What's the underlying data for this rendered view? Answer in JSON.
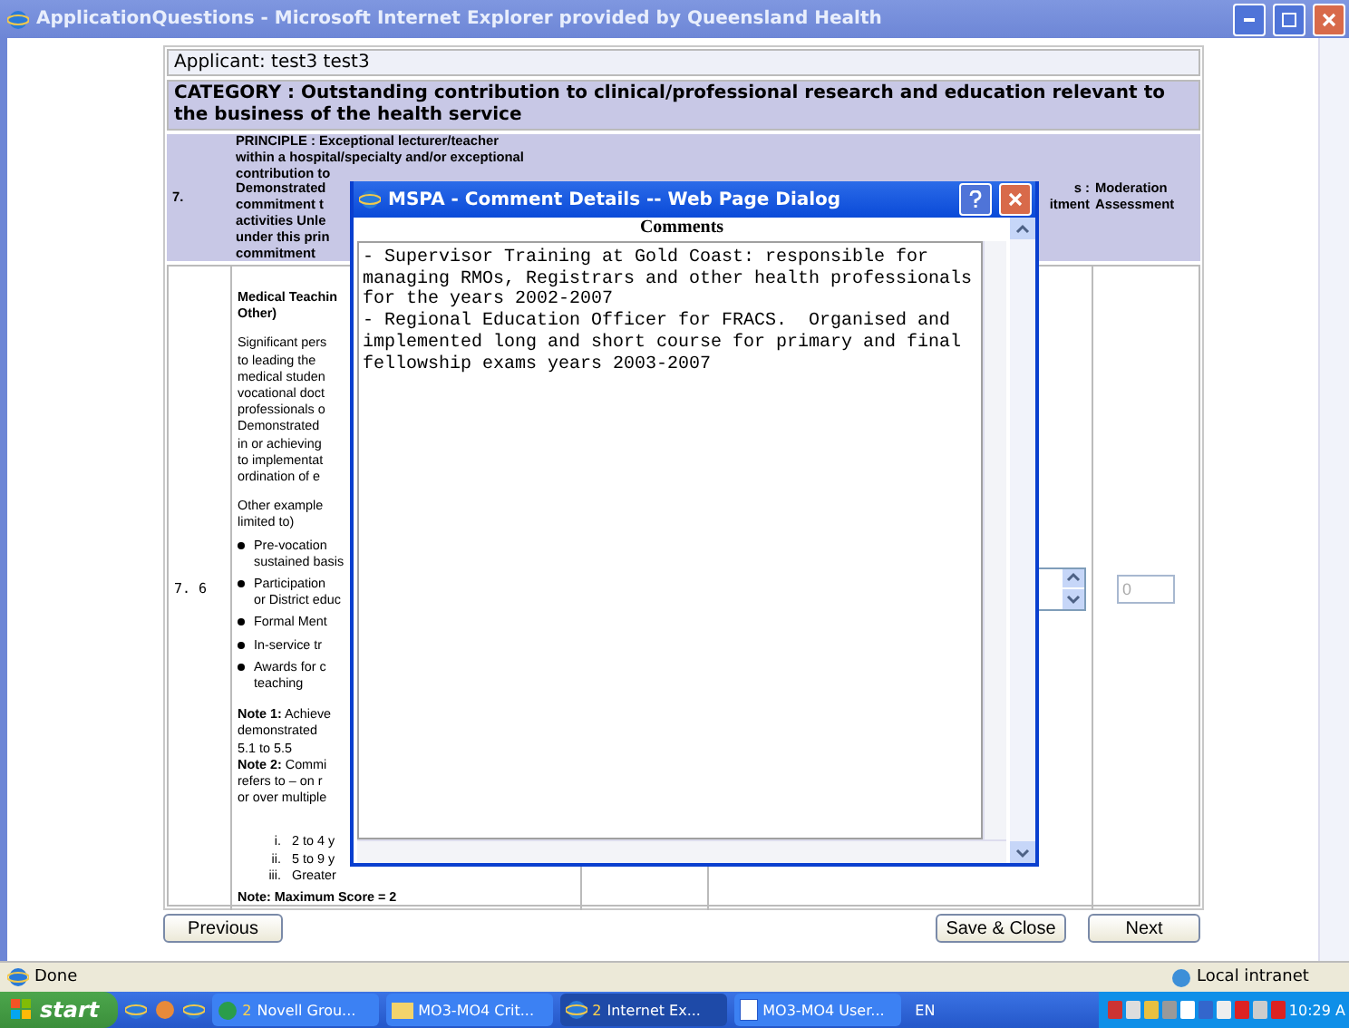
{
  "window": {
    "title": "ApplicationQuestions - Microsoft Internet Explorer provided by Queensland Health"
  },
  "page": {
    "applicant": "Applicant: test3 test3",
    "category": "CATEGORY : Outstanding contribution to clinical/professional research and education relevant to the business of the health service",
    "principle": {
      "number": "7.",
      "lines": [
        "PRINCIPLE : Exceptional lecturer/teacher",
        "within a hospital/specialty and/or exceptional",
        "contribution to",
        "Demonstrated",
        "commitment t",
        "activities Unle",
        "under this prin",
        "commitment"
      ],
      "assessment_header": [
        "s :",
        "itment"
      ],
      "moderation_header": "Moderation Assessment"
    },
    "row": {
      "number": "7. 6",
      "criteria": [
        {
          "kind": "heading",
          "lines": [
            "Medical Teachin",
            "Other)"
          ]
        },
        {
          "kind": "paragraph",
          "lines": [
            "Significant pers",
            "to leading the",
            "medical studen",
            "vocational doct",
            "professionals o",
            "Demonstrated",
            "in or achieving",
            "to implementat",
            "ordination of e"
          ]
        },
        {
          "kind": "paragraph",
          "lines": [
            "Other example",
            "limited to)"
          ]
        },
        {
          "kind": "bullet",
          "lines": [
            "Pre-vocation",
            "sustained basis"
          ]
        },
        {
          "kind": "bullet",
          "lines": [
            "Participation",
            "or District educ"
          ]
        },
        {
          "kind": "bullet",
          "lines": [
            "Formal Ment"
          ]
        },
        {
          "kind": "bullet",
          "lines": [
            "In-service tr"
          ]
        },
        {
          "kind": "bullet",
          "lines": [
            "Awards for c",
            "teaching"
          ]
        },
        {
          "kind": "paragraph",
          "lines": [
            "**Note 1:** Achieve",
            "demonstrated",
            "5.1 to 5.5",
            "**Note 2:** Commi",
            "refers to – on r",
            "or over multiple"
          ]
        },
        {
          "kind": "numbered",
          "marker": "i.",
          "lines": [
            "2 to 4 y"
          ]
        },
        {
          "kind": "numbered",
          "marker": "ii.",
          "lines": [
            "5 to 9 y"
          ]
        },
        {
          "kind": "numbered",
          "marker": "iii.",
          "lines": [
            "Greater"
          ]
        }
      ],
      "footer": "Note: Maximum Score = 2",
      "moderation_value": "0",
      "moderation_disabled": true
    },
    "buttons": {
      "previous": "Previous",
      "save": "Save & Close",
      "next": "Next"
    }
  },
  "dialog": {
    "title": "MSPA - Comment Details -- Web Page Dialog",
    "heading": "Comments",
    "comment_lines": [
      "- Supervisor Training at Gold Coast: responsible for",
      "managing RMOs, Registrars and other health professionals",
      "for the years 2002-2007",
      "- Regional Education Officer for FRACS.  Organised and",
      "implemented long and short course for primary and final",
      "fellowship exams years 2003-2007"
    ]
  },
  "status_bar": {
    "status": "Done",
    "zone": "Local intranet"
  },
  "taskbar": {
    "start": "start",
    "tasks": [
      {
        "count": "2",
        "label": "Novell Grou...",
        "selected": false
      },
      {
        "label": "MO3-MO4 Crit...",
        "selected": false
      },
      {
        "count": "2",
        "label": "Internet Ex...",
        "selected": true
      },
      {
        "label": "MO3-MO4 User...",
        "selected": false
      }
    ],
    "language": "EN",
    "clock": "10:29 A"
  }
}
